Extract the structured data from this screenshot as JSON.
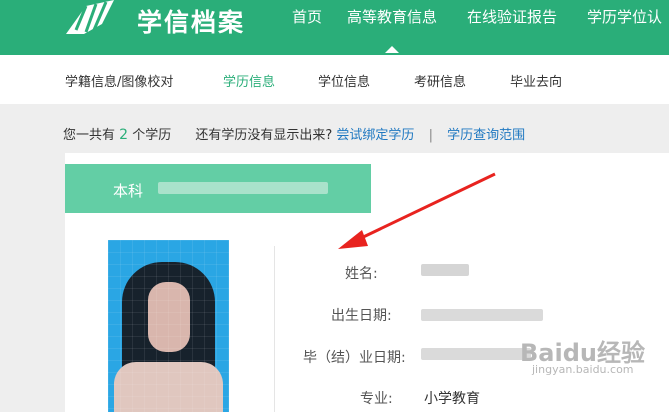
{
  "header": {
    "logo_icon": "stacked-book-icon",
    "logo_text": "学信档案",
    "nav": [
      "首页",
      "高等教育信息",
      "在线验证报告",
      "学历学位认"
    ],
    "active_nav_index": 1
  },
  "subnav": {
    "items": [
      "学籍信息/图像校对",
      "学历信息",
      "学位信息",
      "考研信息",
      "毕业去向"
    ],
    "active_index": 1
  },
  "info": {
    "prefix": "您一共有",
    "count": "2",
    "suffix": "个学历",
    "question": "还有学历没有显示出来?",
    "link_bind": "尝试绑定学历",
    "separator": "|",
    "link_scope": "学历查询范围"
  },
  "record": {
    "level": "本科",
    "fields": [
      {
        "label": "姓名:",
        "value": ""
      },
      {
        "label": "出生日期:",
        "value": ""
      },
      {
        "label": "毕（结）业日期:",
        "value": ""
      },
      {
        "label": "专业:",
        "value": "小学教育"
      }
    ]
  },
  "watermark": {
    "brand": "Baidu经验",
    "url": "jingyan.baidu.com"
  },
  "colors": {
    "brand_green": "#2aae79",
    "tab_green": "#63cea5",
    "link_blue": "#1f78c1",
    "arrow_red": "#e8231f"
  }
}
